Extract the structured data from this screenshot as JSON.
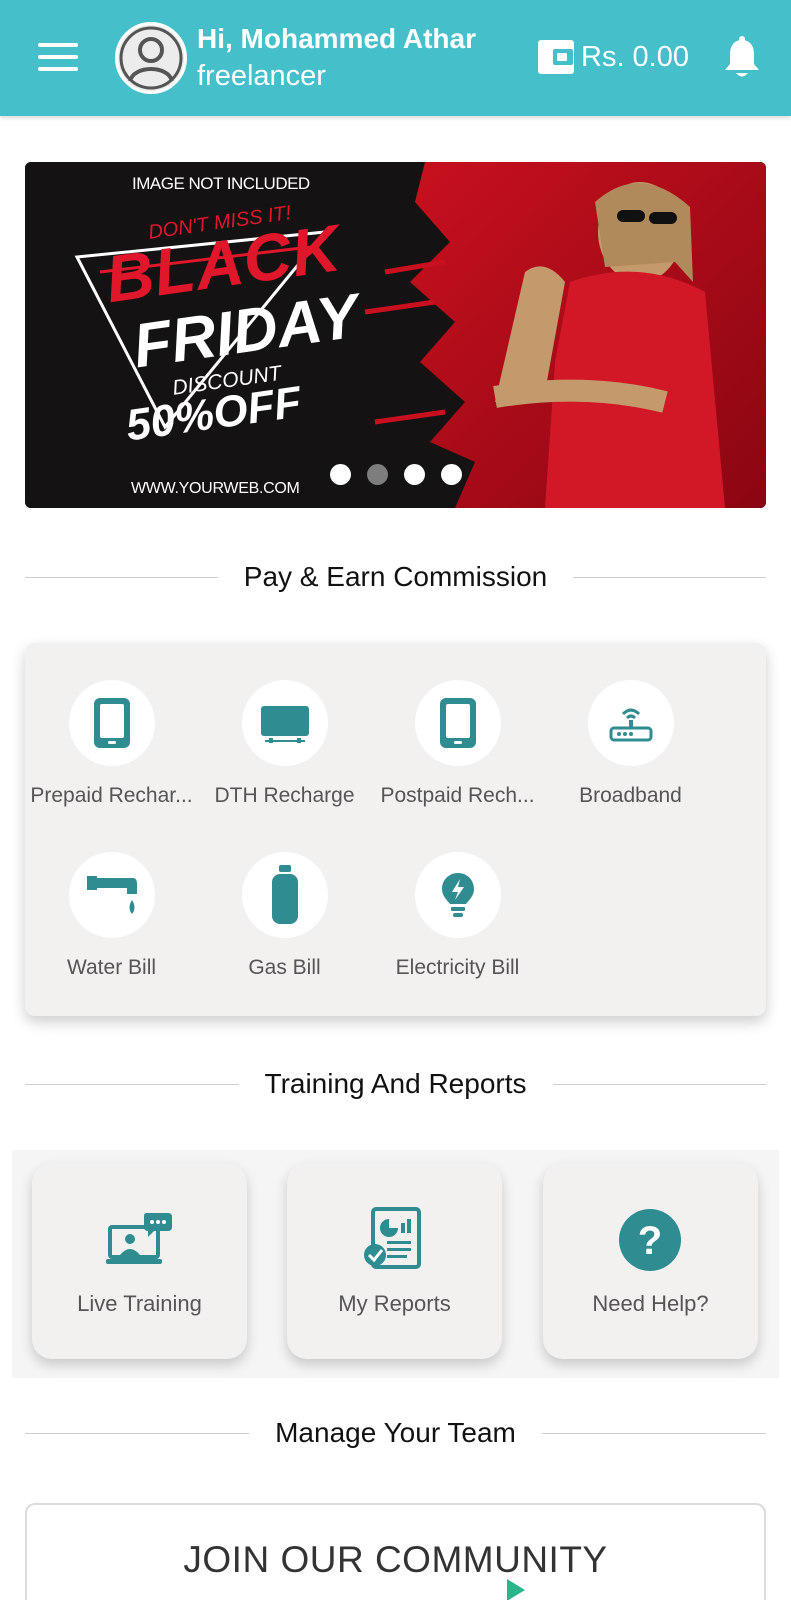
{
  "header": {
    "greeting": "Hi, Mohammed Athar",
    "role": "freelancer",
    "wallet_balance": "Rs. 0.00",
    "icons": [
      "menu-icon",
      "avatar-icon",
      "wallet-icon",
      "bell-icon"
    ]
  },
  "banner": {
    "not_included": "IMAGE NOT INCLUDED",
    "dont_miss": "DON'T MISS IT!",
    "black": "BLACK",
    "friday": "FRIDAY",
    "discount": "DISCOUNT",
    "off": "50%OFF",
    "website": "WWW.YOURWEB.COM",
    "slides": 4,
    "active_slide": 2
  },
  "sections": {
    "pay": "Pay & Earn Commission",
    "training": "Training And Reports",
    "team": "Manage Your Team"
  },
  "services": [
    {
      "label": "Prepaid Rechar...",
      "icon": "mobile-icon"
    },
    {
      "label": "DTH Recharge",
      "icon": "tv-icon"
    },
    {
      "label": "Postpaid Rech...",
      "icon": "mobile-icon"
    },
    {
      "label": "Broadband",
      "icon": "router-icon"
    },
    {
      "label": "Water Bill",
      "icon": "tap-icon"
    },
    {
      "label": "Gas Bill",
      "icon": "gas-cylinder-icon"
    },
    {
      "label": "Electricity Bill",
      "icon": "bulb-icon"
    }
  ],
  "training": [
    {
      "label": "Live Training",
      "icon": "live-training-icon"
    },
    {
      "label": "My Reports",
      "icon": "report-icon"
    },
    {
      "label": "Need Help?",
      "icon": "help-icon"
    }
  ],
  "community": {
    "title": "JOIN OUR COMMUNITY"
  },
  "colors": {
    "header": "#45bfc9",
    "icon": "#2f8c90",
    "banner_red": "#e0162b"
  }
}
